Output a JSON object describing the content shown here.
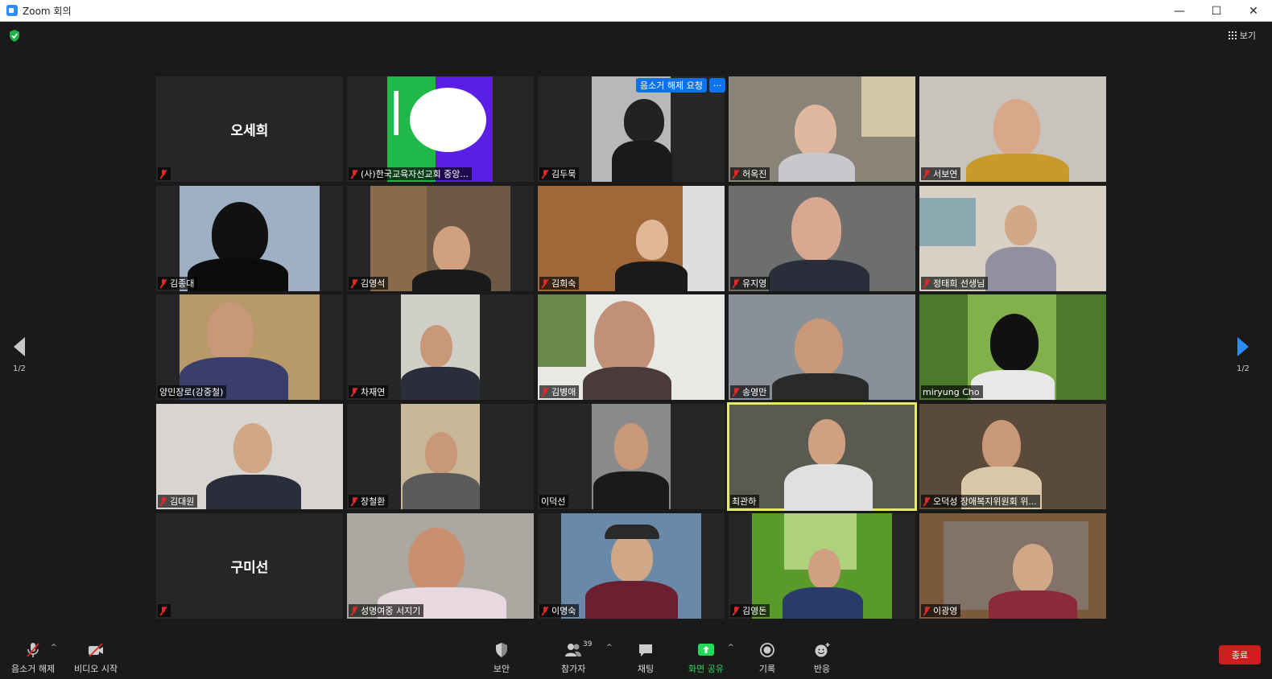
{
  "window": {
    "title": "Zoom 회의",
    "minimize": "—",
    "maximize": "☐",
    "close": "✕"
  },
  "top": {
    "view_label": "보기"
  },
  "unmute_request": {
    "label": "음소거 해제 요청",
    "more": "···"
  },
  "pager": {
    "left_page": "1/2",
    "right_page": "1/2"
  },
  "tiles": [
    {
      "name": "오세희",
      "muted": true,
      "video": false
    },
    {
      "name": "(사)한국교육자선교회 중앙...",
      "muted": true,
      "video": true
    },
    {
      "name": "김두묵",
      "muted": true,
      "video": true
    },
    {
      "name": "허옥진",
      "muted": true,
      "video": true
    },
    {
      "name": "서보연",
      "muted": true,
      "video": true
    },
    {
      "name": "김종대",
      "muted": true,
      "video": true
    },
    {
      "name": "김영석",
      "muted": true,
      "video": true
    },
    {
      "name": "김희숙",
      "muted": true,
      "video": true
    },
    {
      "name": "유지영",
      "muted": true,
      "video": true
    },
    {
      "name": "정태희 선생님",
      "muted": true,
      "video": true
    },
    {
      "name": "양민장로(강중철)",
      "muted": false,
      "video": true
    },
    {
      "name": "차재연",
      "muted": true,
      "video": true
    },
    {
      "name": "김병애",
      "muted": true,
      "video": true
    },
    {
      "name": "송영만",
      "muted": true,
      "video": true
    },
    {
      "name": "miryung Cho",
      "muted": false,
      "video": true
    },
    {
      "name": "김대원",
      "muted": true,
      "video": true
    },
    {
      "name": "장철환",
      "muted": true,
      "video": true
    },
    {
      "name": "이덕선",
      "muted": false,
      "video": true
    },
    {
      "name": "최관하",
      "muted": false,
      "video": true
    },
    {
      "name": "오덕성 장애복지위원회 위...",
      "muted": true,
      "video": true
    },
    {
      "name": "구미선",
      "muted": true,
      "video": false
    },
    {
      "name": "성명여중 서지기",
      "muted": true,
      "video": true
    },
    {
      "name": "이명숙",
      "muted": true,
      "video": true
    },
    {
      "name": "김영돈",
      "muted": true,
      "video": true
    },
    {
      "name": "이광영",
      "muted": true,
      "video": true
    }
  ],
  "toolbar": {
    "unmute": "음소거 해제",
    "video_start": "비디오 시작",
    "security": "보안",
    "participants": "참가자",
    "participants_count": "39",
    "chat": "채팅",
    "share_screen": "화면 공유",
    "record": "기록",
    "reactions": "반응",
    "end": "종료"
  },
  "colors": {
    "accent": "#2d8cff",
    "share": "#23d959",
    "end": "#cf1d1d",
    "active_speaker": "#e6e86c",
    "mute_red": "#e02828"
  }
}
